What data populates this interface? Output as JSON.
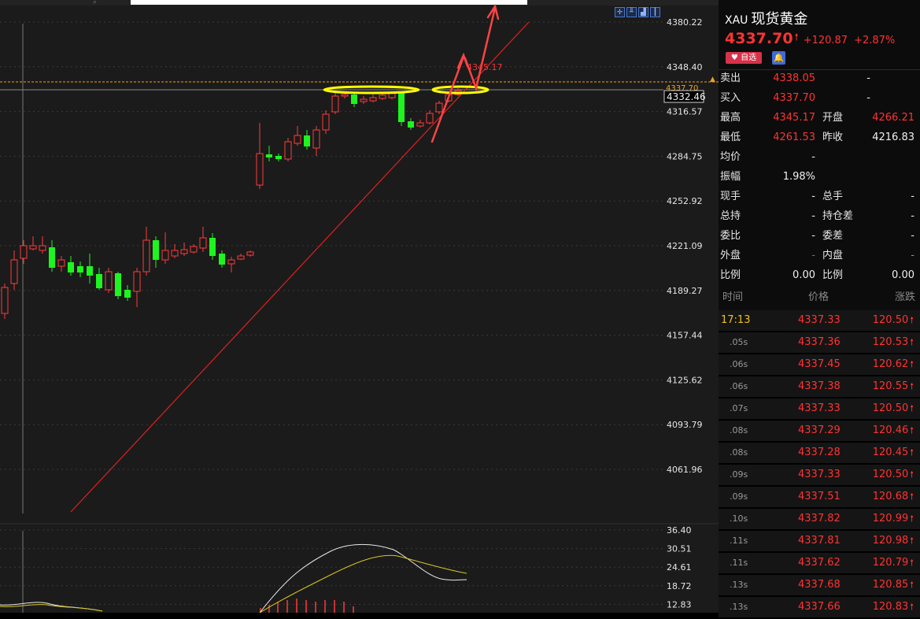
{
  "chart": {
    "price_axis": [
      "4380.22",
      "4348.40",
      "4316.57",
      "4284.75",
      "4252.92",
      "4221.09",
      "4189.27",
      "4157.44",
      "4125.62",
      "4093.79",
      "4061.96"
    ],
    "last_price_tag": "4332.46",
    "ask_price_tag": "4337.70",
    "annotation_high": "4345.17",
    "indicator_axis": [
      "36.40",
      "30.51",
      "24.61",
      "18.72",
      "12.83"
    ],
    "colors": {
      "up": "#ff3b3b",
      "down": "#1ef51e",
      "highlight": "#ffff00",
      "trend": "#e02020"
    },
    "tools": [
      "crosshair-icon",
      "bar-chart-icon",
      "line-chart-icon",
      "candlestick-icon"
    ]
  },
  "quote": {
    "symbol": "XAU",
    "name": "现货黄金",
    "price": "4337.70",
    "change": "+120.87",
    "change_pct": "+2.87%",
    "watch_label": "自选",
    "fields": [
      {
        "l1": "卖出",
        "v1": "4338.05",
        "v1c": "red",
        "l2": "",
        "v2": "-",
        "v2c": "white"
      },
      {
        "l1": "买入",
        "v1": "4337.70",
        "v1c": "red",
        "l2": "",
        "v2": "-",
        "v2c": "white"
      },
      {
        "l1": "最高",
        "v1": "4345.17",
        "v1c": "red",
        "l2": "开盘",
        "v2": "4266.21",
        "v2c": "red"
      },
      {
        "l1": "最低",
        "v1": "4261.53",
        "v1c": "red",
        "l2": "昨收",
        "v2": "4216.83",
        "v2c": "white"
      },
      {
        "l1": "均价",
        "v1": "-",
        "v1c": "white",
        "l2": "",
        "v2": "",
        "v2c": "white"
      },
      {
        "l1": "振幅",
        "v1": "1.98%",
        "v1c": "white",
        "l2": "",
        "v2": "",
        "v2c": "white"
      },
      {
        "l1": "现手",
        "v1": "-",
        "v1c": "white",
        "l2": "总手",
        "v2": "-",
        "v2c": "white"
      },
      {
        "l1": "总持",
        "v1": "-",
        "v1c": "white",
        "l2": "持仓差",
        "v2": "-",
        "v2c": "white"
      },
      {
        "l1": "委比",
        "v1": "-",
        "v1c": "white",
        "l2": "委差",
        "v2": "-",
        "v2c": "white"
      },
      {
        "l1": "外盘",
        "v1": "-",
        "v1c": "red",
        "l2": "内盘",
        "v2": "-",
        "v2c": "green"
      },
      {
        "l1": "比例",
        "v1": "0.00",
        "v1c": "white",
        "l2": "比例",
        "v2": "0.00",
        "v2c": "white"
      }
    ]
  },
  "trades": {
    "headers": {
      "time": "时间",
      "price": "价格",
      "change": "涨跌"
    },
    "rows": [
      {
        "time": "17:13",
        "price": "4337.33",
        "change": "120.50"
      },
      {
        "time": ".05s",
        "price": "4337.36",
        "change": "120.53"
      },
      {
        "time": ".06s",
        "price": "4337.45",
        "change": "120.62"
      },
      {
        "time": ".06s",
        "price": "4337.38",
        "change": "120.55"
      },
      {
        "time": ".07s",
        "price": "4337.33",
        "change": "120.50"
      },
      {
        "time": ".08s",
        "price": "4337.29",
        "change": "120.46"
      },
      {
        "time": ".08s",
        "price": "4337.28",
        "change": "120.45"
      },
      {
        "time": ".09s",
        "price": "4337.33",
        "change": "120.50"
      },
      {
        "time": ".09s",
        "price": "4337.51",
        "change": "120.68"
      },
      {
        "time": ".10s",
        "price": "4337.82",
        "change": "120.99"
      },
      {
        "time": ".11s",
        "price": "4337.81",
        "change": "120.98"
      },
      {
        "time": ".11s",
        "price": "4337.62",
        "change": "120.79"
      },
      {
        "time": ".13s",
        "price": "4337.68",
        "change": "120.85"
      },
      {
        "time": ".13s",
        "price": "4337.66",
        "change": "120.83"
      }
    ]
  }
}
